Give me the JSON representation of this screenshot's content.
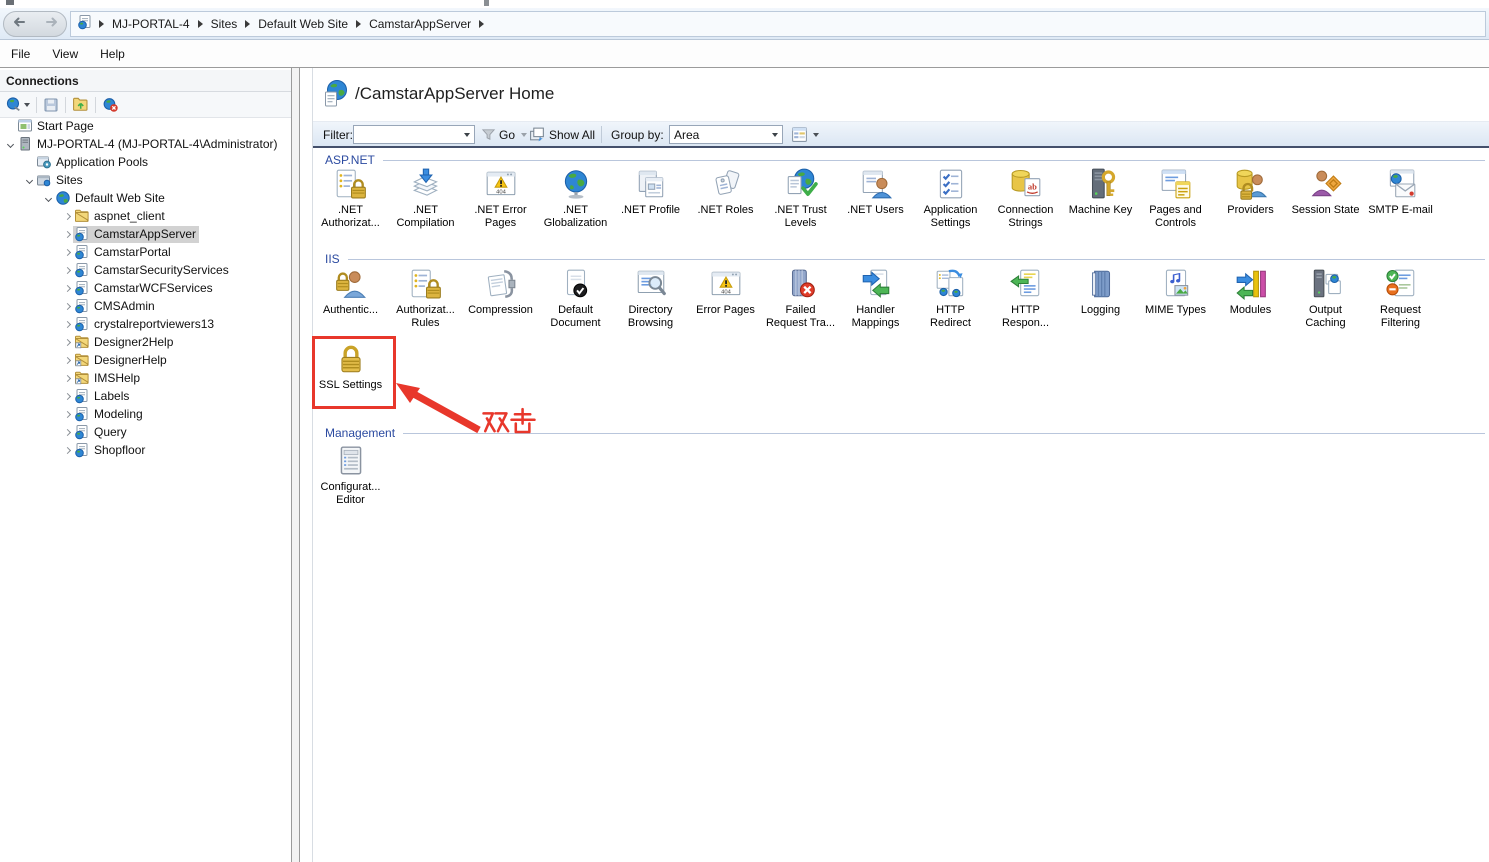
{
  "address": {
    "breadcrumb": [
      "MJ-PORTAL-4",
      "Sites",
      "Default Web Site",
      "CamstarAppServer"
    ]
  },
  "menu": {
    "items": [
      "File",
      "View",
      "Help"
    ]
  },
  "connections": {
    "title": "Connections",
    "toolbar_icons": [
      "connect-server-icon",
      "save-connections-icon",
      "up-folder-icon",
      "delete-connection-icon"
    ],
    "tree": [
      {
        "label": "Start Page",
        "icon": "start-page",
        "depth": 0,
        "chevron": null,
        "selected": false
      },
      {
        "label": "MJ-PORTAL-4 (MJ-PORTAL-4\\Administrator)",
        "icon": "server",
        "depth": 0,
        "chevron": "down",
        "selected": false
      },
      {
        "label": "Application Pools",
        "icon": "app-pools",
        "depth": 1,
        "chevron": null,
        "selected": false
      },
      {
        "label": "Sites",
        "icon": "sites",
        "depth": 1,
        "chevron": "down",
        "selected": false
      },
      {
        "label": "Default Web Site",
        "icon": "site-globe",
        "depth": 2,
        "chevron": "down",
        "selected": false
      },
      {
        "label": "aspnet_client",
        "icon": "folder",
        "depth": 3,
        "chevron": "right",
        "selected": false
      },
      {
        "label": "CamstarAppServer",
        "icon": "webapp",
        "depth": 3,
        "chevron": "right",
        "selected": true
      },
      {
        "label": "CamstarPortal",
        "icon": "webapp",
        "depth": 3,
        "chevron": "right",
        "selected": false
      },
      {
        "label": "CamstarSecurityServices",
        "icon": "webapp",
        "depth": 3,
        "chevron": "right",
        "selected": false
      },
      {
        "label": "CamstarWCFServices",
        "icon": "webapp",
        "depth": 3,
        "chevron": "right",
        "selected": false
      },
      {
        "label": "CMSAdmin",
        "icon": "webapp",
        "depth": 3,
        "chevron": "right",
        "selected": false
      },
      {
        "label": "crystalreportviewers13",
        "icon": "webapp",
        "depth": 3,
        "chevron": "right",
        "selected": false
      },
      {
        "label": "Designer2Help",
        "icon": "vdir",
        "depth": 3,
        "chevron": "right",
        "selected": false
      },
      {
        "label": "DesignerHelp",
        "icon": "vdir",
        "depth": 3,
        "chevron": "right",
        "selected": false
      },
      {
        "label": "IMSHelp",
        "icon": "vdir",
        "depth": 3,
        "chevron": "right",
        "selected": false
      },
      {
        "label": "Labels",
        "icon": "webapp",
        "depth": 3,
        "chevron": "right",
        "selected": false
      },
      {
        "label": "Modeling",
        "icon": "webapp",
        "depth": 3,
        "chevron": "right",
        "selected": false
      },
      {
        "label": "Query",
        "icon": "webapp",
        "depth": 3,
        "chevron": "right",
        "selected": false
      },
      {
        "label": "Shopfloor",
        "icon": "webapp",
        "depth": 3,
        "chevron": "right",
        "selected": false
      }
    ]
  },
  "page": {
    "title": "/CamstarAppServer Home"
  },
  "filterbar": {
    "filter_label": "Filter:",
    "filter_value": "",
    "go_label": "Go",
    "show_all_label": "Show All",
    "group_by_label": "Group by:",
    "group_by_value": "Area"
  },
  "sections": {
    "aspnet": {
      "header": "ASP.NET",
      "items": [
        {
          "label": [
            ".NET",
            "Authorizat..."
          ],
          "icon": "net-authorization"
        },
        {
          "label": [
            ".NET",
            "Compilation"
          ],
          "icon": "net-compilation"
        },
        {
          "label": [
            ".NET Error",
            "Pages"
          ],
          "icon": "net-error-pages"
        },
        {
          "label": [
            ".NET",
            "Globalization"
          ],
          "icon": "net-globalization"
        },
        {
          "label": [
            ".NET Profile"
          ],
          "icon": "net-profile"
        },
        {
          "label": [
            ".NET Roles"
          ],
          "icon": "net-roles"
        },
        {
          "label": [
            ".NET Trust",
            "Levels"
          ],
          "icon": "net-trust-levels"
        },
        {
          "label": [
            ".NET Users"
          ],
          "icon": "net-users"
        },
        {
          "label": [
            "Application",
            "Settings"
          ],
          "icon": "application-settings"
        },
        {
          "label": [
            "Connection",
            "Strings"
          ],
          "icon": "connection-strings"
        },
        {
          "label": [
            "Machine Key"
          ],
          "icon": "machine-key"
        },
        {
          "label": [
            "Pages and",
            "Controls"
          ],
          "icon": "pages-and-controls"
        },
        {
          "label": [
            "Providers"
          ],
          "icon": "providers"
        },
        {
          "label": [
            "Session State"
          ],
          "icon": "session-state"
        },
        {
          "label": [
            "SMTP E-mail"
          ],
          "icon": "smtp-email"
        }
      ]
    },
    "iis": {
      "header": "IIS",
      "row1": [
        {
          "label": [
            "Authentic..."
          ],
          "icon": "authentication"
        },
        {
          "label": [
            "Authorizat...",
            "Rules"
          ],
          "icon": "authorization-rules"
        },
        {
          "label": [
            "Compression"
          ],
          "icon": "compression"
        },
        {
          "label": [
            "Default",
            "Document"
          ],
          "icon": "default-document"
        },
        {
          "label": [
            "Directory",
            "Browsing"
          ],
          "icon": "directory-browsing"
        },
        {
          "label": [
            "Error Pages"
          ],
          "icon": "error-pages"
        },
        {
          "label": [
            "Failed",
            "Request Tra..."
          ],
          "icon": "failed-request-tracing"
        },
        {
          "label": [
            "Handler",
            "Mappings"
          ],
          "icon": "handler-mappings"
        },
        {
          "label": [
            "HTTP",
            "Redirect"
          ],
          "icon": "http-redirect"
        },
        {
          "label": [
            "HTTP",
            "Respon..."
          ],
          "icon": "http-response"
        },
        {
          "label": [
            "Logging"
          ],
          "icon": "logging"
        },
        {
          "label": [
            "MIME Types"
          ],
          "icon": "mime-types"
        },
        {
          "label": [
            "Modules"
          ],
          "icon": "modules"
        },
        {
          "label": [
            "Output",
            "Caching"
          ],
          "icon": "output-caching"
        },
        {
          "label": [
            "Request",
            "Filtering"
          ],
          "icon": "request-filtering"
        }
      ],
      "row2": [
        {
          "label": [
            "SSL Settings"
          ],
          "icon": "ssl-settings"
        }
      ]
    },
    "management": {
      "header": "Management",
      "items": [
        {
          "label": [
            "Configurat...",
            "Editor"
          ],
          "icon": "configuration-editor"
        }
      ]
    }
  },
  "annotation": {
    "text": "双击",
    "color": "#e8372b"
  }
}
